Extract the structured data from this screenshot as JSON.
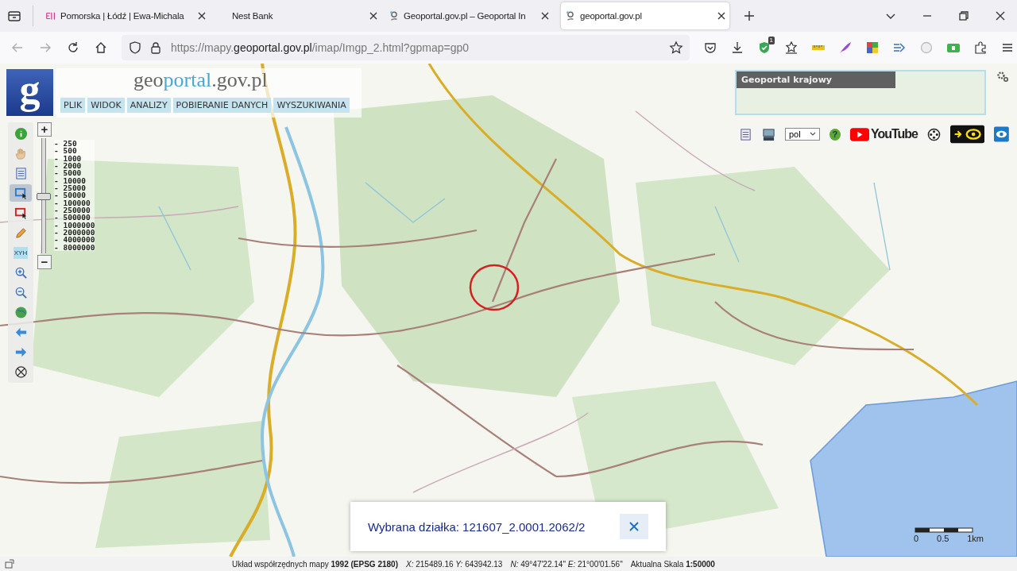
{
  "browser": {
    "tabs": [
      {
        "title": "Pomorska | Łódź | Ewa-Michala",
        "kind": "pink",
        "selected": false
      },
      {
        "title": "Nest Bank",
        "kind": "plain",
        "selected": false
      },
      {
        "title": "Geoportal.gov.pl – Geoportal In",
        "kind": "geoportal",
        "selected": false
      },
      {
        "title": "geoportal.gov.pl",
        "kind": "geoportal",
        "selected": true
      }
    ],
    "url_parts": [
      "https://mapy.",
      "geoportal.gov.pl",
      "/imap/Imgp_2.html?gpmap=gp0"
    ],
    "extension_badge": "1"
  },
  "portal": {
    "logo": "g",
    "title_parts": [
      "geo",
      "portal",
      ".gov.pl"
    ],
    "menu": [
      "PLIK",
      "WIDOK",
      "ANALIZY",
      "POBIERANIE DANYCH",
      "WYSZUKIWANIA"
    ]
  },
  "tools": [
    {
      "kind": "info",
      "selected": false
    },
    {
      "kind": "hand",
      "selected": false
    },
    {
      "kind": "legend",
      "selected": false
    },
    {
      "kind": "select-blue",
      "selected": true
    },
    {
      "kind": "select-red",
      "selected": false
    },
    {
      "kind": "pencil",
      "selected": false
    },
    {
      "kind": "xyh",
      "label": "XYH",
      "selected": false
    },
    {
      "kind": "zoom-in",
      "selected": false
    },
    {
      "kind": "zoom-out",
      "selected": false
    },
    {
      "kind": "globe",
      "selected": false
    },
    {
      "kind": "back",
      "selected": false
    },
    {
      "kind": "forward",
      "selected": false
    },
    {
      "kind": "crosshair",
      "selected": false
    }
  ],
  "zoom": {
    "plus": "+",
    "minus": "−",
    "level": 0.5,
    "scales": [
      "- 250",
      "- 500",
      "- 1000",
      "- 2000",
      "- 5000",
      "- 10000",
      "- 25000",
      "- 50000",
      "- 100000",
      "- 250000",
      "- 500000",
      "- 1000000",
      "- 2000000",
      "- 4000000",
      "- 8000000"
    ]
  },
  "overview": {
    "title": "Geoportal krajowy"
  },
  "topbar": {
    "language": "pol",
    "help": "?",
    "youtube": "YouTube"
  },
  "notice": {
    "text": "Wybrana działka: 121607_2.0001.2062/2"
  },
  "scalebar": {
    "labels": [
      "0",
      "0.5",
      "1km"
    ]
  },
  "status": {
    "parts": [
      "Układ współrzędnych mapy **1992 (EPSG 2180)**",
      "*X:* 215489.16 *Y:* 643942.13",
      "*N:* 49°47'22.14\" *E:* 21°00'01.56\"",
      "Aktualna Skala **1:50000**"
    ]
  }
}
